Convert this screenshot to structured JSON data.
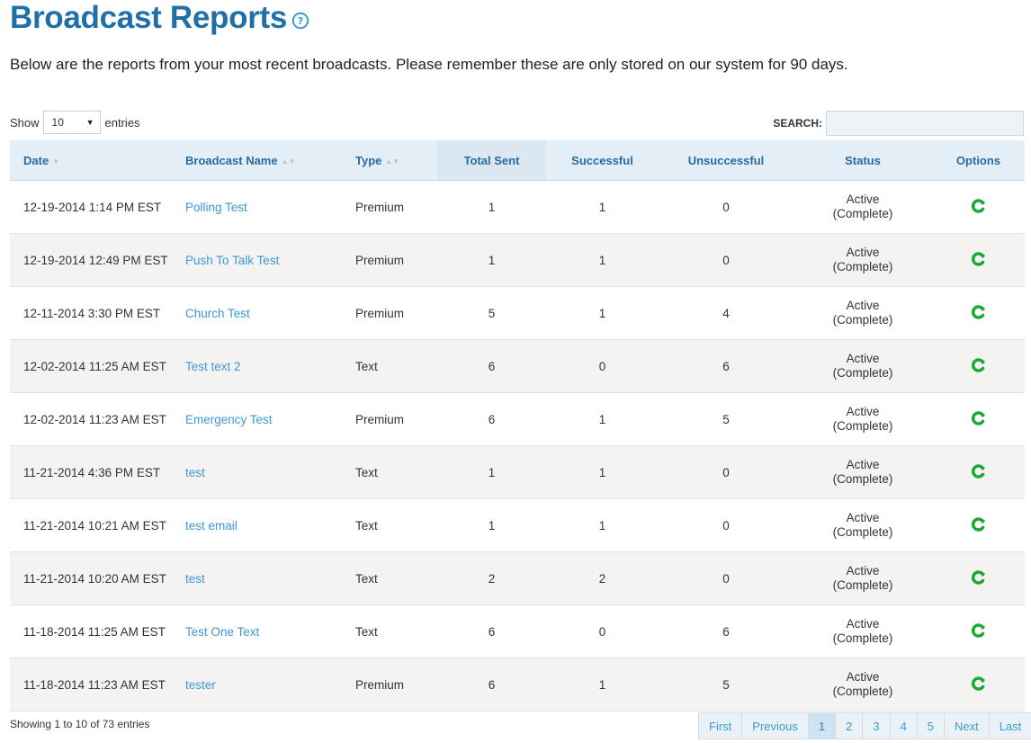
{
  "page": {
    "title": "Broadcast Reports",
    "subtitle": "Below are the reports from your most recent broadcasts. Please remember these are only stored on our system for 90 days."
  },
  "controls": {
    "show_label": "Show",
    "entries_value": "10",
    "entries_label": "entries",
    "search_label": "SEARCH:",
    "search_value": ""
  },
  "table": {
    "headers": {
      "date": "Date",
      "name": "Broadcast Name",
      "type": "Type",
      "total": "Total Sent",
      "success": "Successful",
      "fail": "Unsuccessful",
      "status": "Status",
      "options": "Options"
    },
    "rows": [
      {
        "date": "12-19-2014 1:14 PM EST",
        "name": "Polling Test",
        "type": "Premium",
        "total": "1",
        "success": "1",
        "fail": "0",
        "status1": "Active",
        "status2": "(Complete)"
      },
      {
        "date": "12-19-2014 12:49 PM EST",
        "name": "Push To Talk Test",
        "type": "Premium",
        "total": "1",
        "success": "1",
        "fail": "0",
        "status1": "Active",
        "status2": "(Complete)"
      },
      {
        "date": "12-11-2014 3:30 PM EST",
        "name": "Church Test",
        "type": "Premium",
        "total": "5",
        "success": "1",
        "fail": "4",
        "status1": "Active",
        "status2": "(Complete)"
      },
      {
        "date": "12-02-2014 11:25 AM EST",
        "name": "Test text 2",
        "type": "Text",
        "total": "6",
        "success": "0",
        "fail": "6",
        "status1": "Active",
        "status2": "(Complete)"
      },
      {
        "date": "12-02-2014 11:23 AM EST",
        "name": "Emergency Test",
        "type": "Premium",
        "total": "6",
        "success": "1",
        "fail": "5",
        "status1": "Active",
        "status2": "(Complete)"
      },
      {
        "date": "11-21-2014 4:36 PM EST",
        "name": "test",
        "type": "Text",
        "total": "1",
        "success": "1",
        "fail": "0",
        "status1": "Active",
        "status2": "(Complete)"
      },
      {
        "date": "11-21-2014 10:21 AM EST",
        "name": "test email",
        "type": "Text",
        "total": "1",
        "success": "1",
        "fail": "0",
        "status1": "Active",
        "status2": "(Complete)"
      },
      {
        "date": "11-21-2014 10:20 AM EST",
        "name": "test",
        "type": "Text",
        "total": "2",
        "success": "2",
        "fail": "0",
        "status1": "Active",
        "status2": "(Complete)"
      },
      {
        "date": "11-18-2014 11:25 AM EST",
        "name": "Test One Text",
        "type": "Text",
        "total": "6",
        "success": "0",
        "fail": "6",
        "status1": "Active",
        "status2": "(Complete)"
      },
      {
        "date": "11-18-2014 11:23 AM EST",
        "name": "tester",
        "type": "Premium",
        "total": "6",
        "success": "1",
        "fail": "5",
        "status1": "Active",
        "status2": "(Complete)"
      }
    ]
  },
  "footer": {
    "info": "Showing 1 to 10 of 73 entries",
    "pager": {
      "first": "First",
      "previous": "Previous",
      "pages": [
        "1",
        "2",
        "3",
        "4",
        "5"
      ],
      "next": "Next",
      "last": "Last"
    }
  },
  "colors": {
    "title": "#1f6fa8",
    "link": "#3a9ad6",
    "header_bg": "#e4eef6",
    "option_icon": "#1aa832"
  },
  "icons": {
    "help": "question-circle-icon",
    "option": "refresh-icon",
    "sort": "sort-arrows-icon"
  }
}
